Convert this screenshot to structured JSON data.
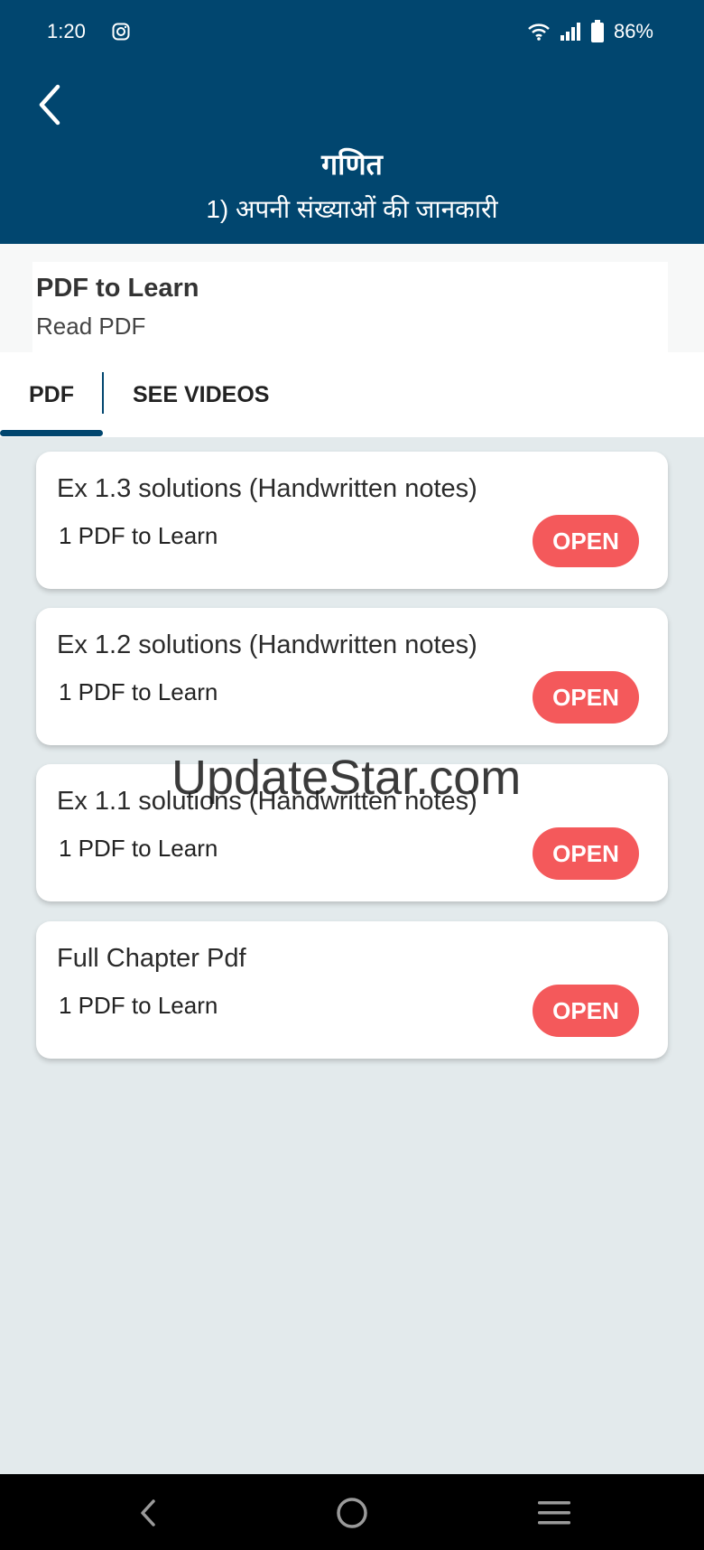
{
  "status_bar": {
    "time": "1:20",
    "battery": "86%"
  },
  "header": {
    "title": "गणित",
    "subtitle": "1)  अपनी संख्याओं की जानकारी"
  },
  "section": {
    "title": "PDF to Learn",
    "subtitle": "Read PDF"
  },
  "tabs": [
    {
      "label": "PDF",
      "active": true
    },
    {
      "label": "SEE VIDEOS",
      "active": false
    }
  ],
  "items": [
    {
      "title": "Ex 1.3 solutions (Handwritten notes)",
      "subtitle": "1 PDF to Learn",
      "button": "OPEN"
    },
    {
      "title": "Ex 1.2 solutions (Handwritten notes)",
      "subtitle": "1 PDF to Learn",
      "button": "OPEN"
    },
    {
      "title": "Ex 1.1 solutions (Handwritten notes)",
      "subtitle": "1 PDF to Learn",
      "button": "OPEN"
    },
    {
      "title": "Full Chapter Pdf",
      "subtitle": "1 PDF to Learn",
      "button": "OPEN"
    }
  ],
  "watermark": "UpdateStar.com",
  "colors": {
    "header_bg": "#01466f",
    "open_button": "#f4595b",
    "list_bg": "#e3eaec"
  }
}
